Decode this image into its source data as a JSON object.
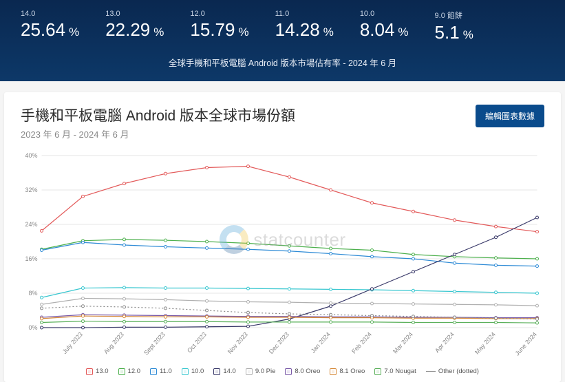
{
  "hero": {
    "stats": [
      {
        "label": "14.0",
        "value": "25.64"
      },
      {
        "label": "13.0",
        "value": "22.29"
      },
      {
        "label": "12.0",
        "value": "15.79"
      },
      {
        "label": "11.0",
        "value": "14.28"
      },
      {
        "label": "10.0",
        "value": "8.04"
      },
      {
        "label": "9.0 餡餅",
        "value": "5.1"
      }
    ],
    "subtitle": "全球手機和平板電腦 Android 版本市場佔有率 - 2024 年 6 月"
  },
  "card": {
    "title": "手機和平板電腦 Android 版本全球市場份額",
    "subtitle": "2023 年 6 月 - 2024 年 6 月",
    "edit_button": "編輯圖表數據"
  },
  "chart_data": {
    "type": "line",
    "ylabel": "%",
    "ylim": [
      0,
      40
    ],
    "yticks": [
      0,
      8,
      16,
      24,
      32,
      40
    ],
    "categories": [
      "July 2023",
      "Aug 2023",
      "Sept 2023",
      "Oct 2023",
      "Nov 2023",
      "Dec 2023",
      "Jan 2024",
      "Feb 2024",
      "Mar 2024",
      "Apr 2024",
      "May 2024",
      "June 2024"
    ],
    "series": [
      {
        "name": "13.0",
        "color": "#e35a5a",
        "values": [
          22.5,
          30.5,
          33.5,
          35.8,
          37.2,
          37.5,
          35.0,
          32.0,
          29.0,
          27.0,
          25.0,
          23.5,
          22.3
        ]
      },
      {
        "name": "12.0",
        "color": "#4db04d",
        "values": [
          18.2,
          20.2,
          20.5,
          20.3,
          20.0,
          19.6,
          19.0,
          18.4,
          18.0,
          17.0,
          16.5,
          16.2,
          16.0
        ]
      },
      {
        "name": "11.0",
        "color": "#2e8bd6",
        "values": [
          18.0,
          19.8,
          19.2,
          18.8,
          18.5,
          18.2,
          17.8,
          17.2,
          16.5,
          16.0,
          15.0,
          14.5,
          14.3
        ]
      },
      {
        "name": "10.0",
        "color": "#38c7d0",
        "values": [
          7.0,
          9.2,
          9.3,
          9.2,
          9.2,
          9.1,
          9.0,
          8.9,
          8.8,
          8.6,
          8.4,
          8.2,
          8.0
        ]
      },
      {
        "name": "14.0",
        "color": "#3a3a6a",
        "values": [
          0.0,
          0.0,
          0.1,
          0.1,
          0.2,
          0.3,
          2.0,
          5.0,
          9.0,
          13.0,
          17.0,
          21.0,
          25.6
        ]
      },
      {
        "name": "9.0 Pie",
        "color": "#b0b0b0",
        "values": [
          5.4,
          6.8,
          6.7,
          6.5,
          6.2,
          6.0,
          5.9,
          5.7,
          5.6,
          5.5,
          5.4,
          5.3,
          5.1
        ]
      },
      {
        "name": "8.0 Oreo",
        "color": "#7a5aa8",
        "values": [
          2.4,
          3.0,
          2.9,
          2.8,
          2.7,
          2.6,
          2.6,
          2.5,
          2.5,
          2.4,
          2.4,
          2.3,
          2.3
        ]
      },
      {
        "name": "8.1 Oreo",
        "color": "#d68a3a",
        "values": [
          2.1,
          2.7,
          2.6,
          2.5,
          2.5,
          2.4,
          2.4,
          2.3,
          2.3,
          2.2,
          2.2,
          2.1,
          2.1
        ]
      },
      {
        "name": "7.0 Nougat",
        "color": "#5ab05a",
        "values": [
          1.2,
          1.5,
          1.4,
          1.4,
          1.4,
          1.3,
          1.3,
          1.3,
          1.3,
          1.2,
          1.2,
          1.2,
          1.1
        ]
      },
      {
        "name": "Other (dotted)",
        "color": "#888888",
        "dotted": true,
        "values": [
          4.5,
          5.0,
          4.8,
          4.5,
          4.0,
          3.5,
          3.2,
          3.0,
          2.8,
          2.6,
          2.4,
          2.2,
          2.0
        ]
      }
    ]
  },
  "watermark": "statcounter"
}
